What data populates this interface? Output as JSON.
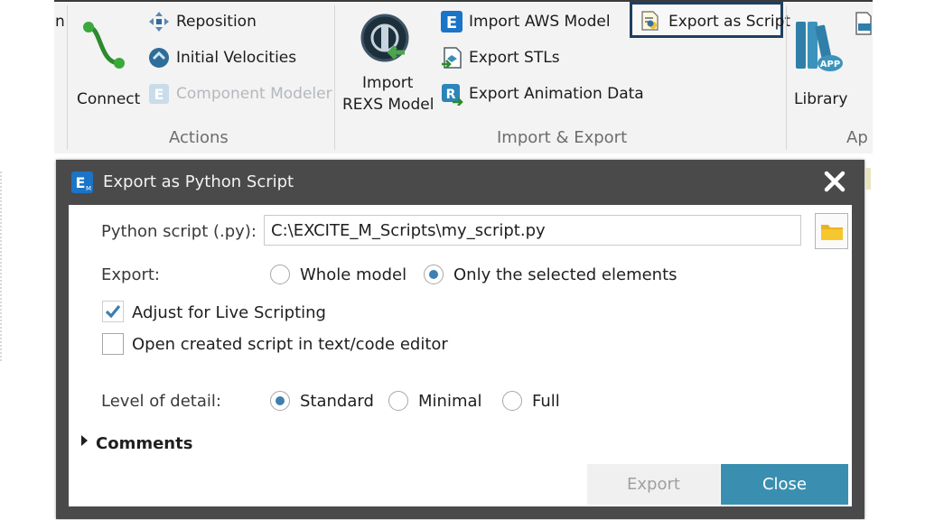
{
  "ribbon": {
    "cut_label": "n",
    "actions": {
      "connect_label": "Connect",
      "reposition_label": "Reposition",
      "initial_velocities_label": "Initial Velocities",
      "component_modeler_label": "Component Modeler",
      "group_label": "Actions"
    },
    "import_export": {
      "import_rexs_line1": "Import",
      "import_rexs_line2": "REXS Model",
      "import_aws_label": "Import AWS Model",
      "export_stls_label": "Export STLs",
      "export_animation_label": "Export Animation Data",
      "export_script_label": "Export as Script",
      "group_label": "Import & Export"
    },
    "apps": {
      "library_label": "Library",
      "group_label": "Ap",
      "app_badge": "APP"
    }
  },
  "dialog": {
    "title": "Export as Python Script",
    "python_script_label": "Python script (.py):",
    "python_script_value": "C:\\EXCITE_M_Scripts\\my_script.py",
    "export_label": "Export:",
    "export_options": [
      "Whole model",
      "Only the selected elements"
    ],
    "export_selected": "Only the selected elements",
    "adjust_live_label": "Adjust for Live Scripting",
    "adjust_live_checked": true,
    "open_editor_label": "Open created script in text/code editor",
    "open_editor_checked": false,
    "detail_label": "Level of detail:",
    "detail_options": [
      "Standard",
      "Minimal",
      "Full"
    ],
    "detail_selected": "Standard",
    "comments_label": "Comments",
    "export_button": "Export",
    "close_button": "Close"
  },
  "colors": {
    "accent": "#3a8fb0",
    "dialog_frame": "#4a4a4a",
    "selection_border": "#1f3f5f"
  }
}
